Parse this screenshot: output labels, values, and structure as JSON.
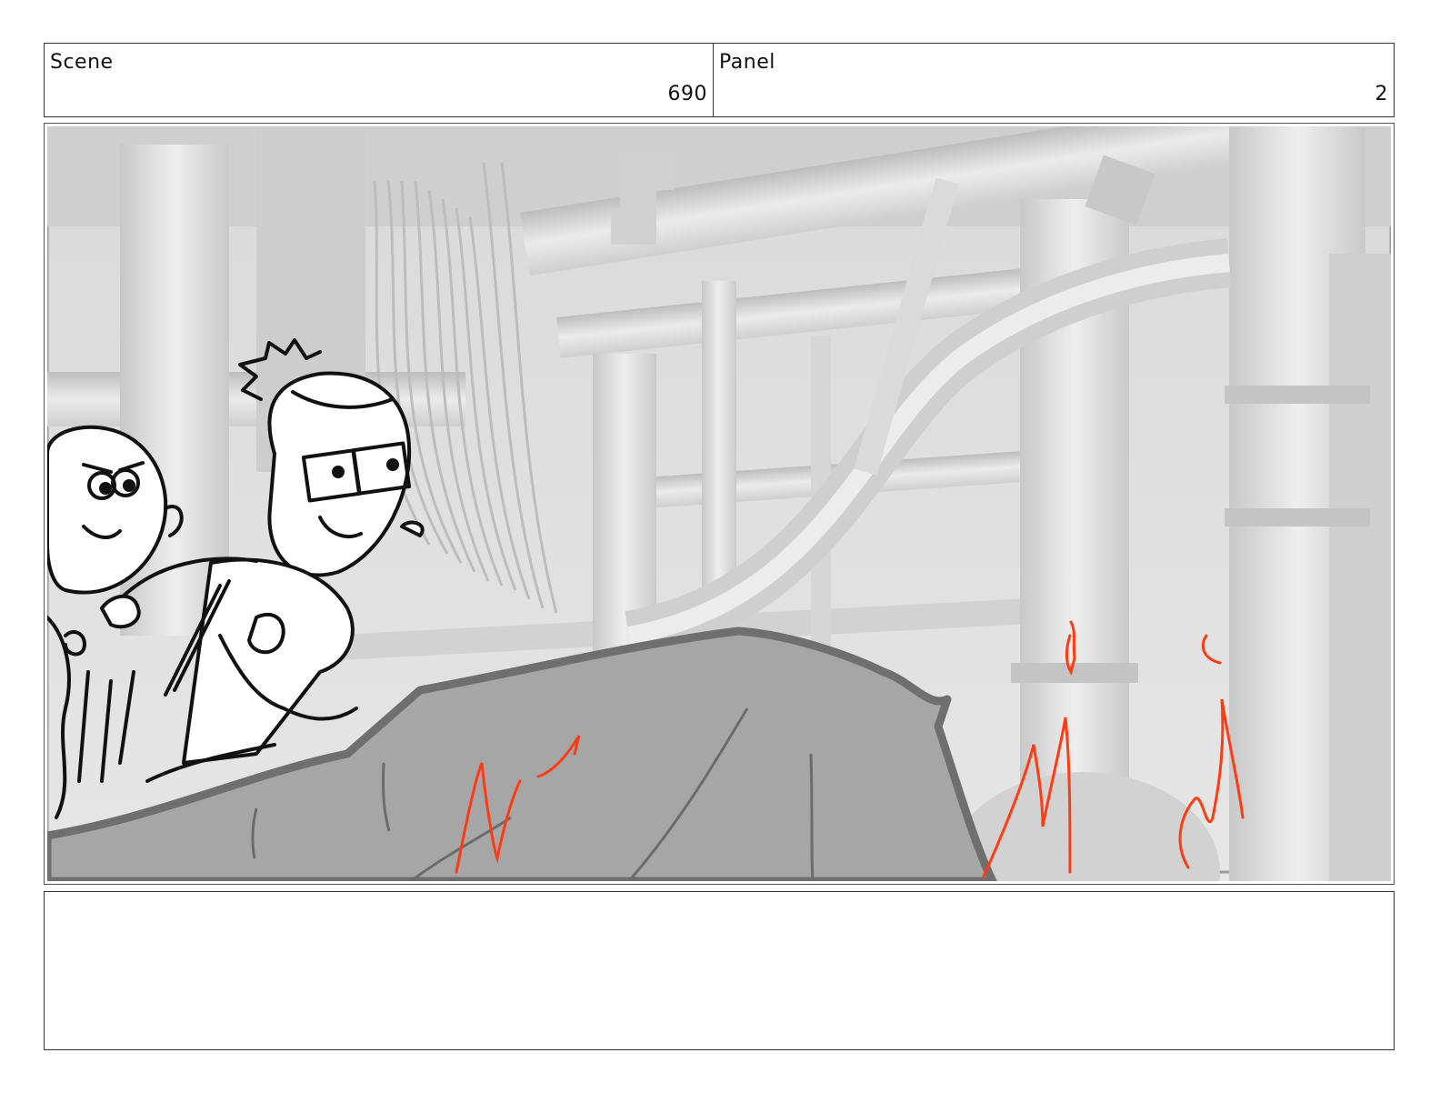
{
  "scene": {
    "label": "Scene",
    "value": "690"
  },
  "panel": {
    "label": "Panel",
    "value": "2"
  },
  "notes": {
    "text": ""
  },
  "colors": {
    "sketch_line": "#111111",
    "annotation": "#ff3b14",
    "background_render": "#dcdcdc",
    "rock": "#a9a9a9"
  }
}
